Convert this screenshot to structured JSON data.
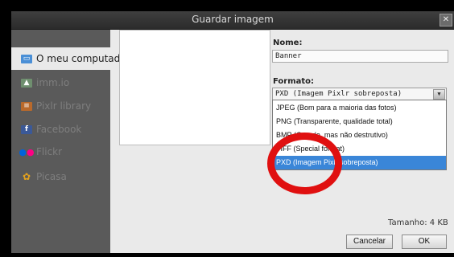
{
  "dialog": {
    "title": "Guardar imagem",
    "close_glyph": "✕"
  },
  "sidebar": {
    "items": [
      {
        "label": "O meu computador",
        "icon": "computer-icon",
        "icon_color": "#4a8fd6",
        "active": true
      },
      {
        "label": "imm.io",
        "icon": "image-icon",
        "icon_color": "#6f8f6f",
        "active": false
      },
      {
        "label": "Pixlr library",
        "icon": "library-icon",
        "icon_color": "#b9692b",
        "active": false
      },
      {
        "label": "Facebook",
        "icon": "facebook-icon",
        "icon_color": "#3b5998",
        "active": false
      },
      {
        "label": "Flickr",
        "icon": "flickr-icon",
        "icon_color": "#ff0084",
        "active": false
      },
      {
        "label": "Picasa",
        "icon": "picasa-icon",
        "icon_color": "#e4a21d",
        "active": false
      }
    ]
  },
  "form": {
    "name_label": "Nome:",
    "name_value": "Banner",
    "format_label": "Formato:",
    "format_selected": "PXD (Imagem Pixlr sobreposta)",
    "format_options": [
      "JPEG (Bom para a maioria das fotos)",
      "PNG (Transparente, qualidade total)",
      "BMP (Grande, mas não destrutivo)",
      "TIFF (Special format)",
      "PXD (Imagem Pixlr sobreposta)"
    ],
    "format_highlighted_index": 4
  },
  "footer": {
    "size_label": "Tamanho: 4 KB",
    "cancel_label": "Cancelar",
    "ok_label": "OK"
  },
  "colors": {
    "titlebar": "#333333",
    "sidebar": "#5a5a5a",
    "selection": "#3a86d8",
    "annotation": "#e01010"
  }
}
